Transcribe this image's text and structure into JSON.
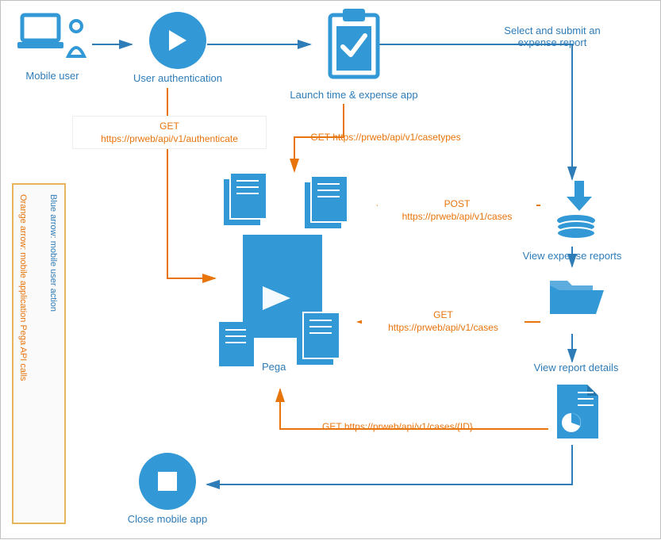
{
  "nodes": {
    "mobile_user": "Mobile user",
    "user_auth": "User authentication",
    "launch_app": "Launch time & expense app",
    "pega": "Pega",
    "close_app": "Close mobile app",
    "view_expense_reports": "View expense reports",
    "view_report_details": "View report details"
  },
  "actions": {
    "select_submit": "Select and submit an expense report"
  },
  "api": {
    "authenticate": {
      "method": "GET",
      "url": "https://prweb/api/v1/authenticate"
    },
    "casetypes": {
      "method": "GET",
      "url": "https://prweb/api/v1/casetypes"
    },
    "post_cases": {
      "method": "POST",
      "url": "https://prweb/api/v1/cases"
    },
    "get_cases": {
      "method": "GET",
      "url": "https://prweb/api/v1/cases"
    },
    "get_case_id": {
      "method": "GET",
      "url": "https://prweb/api/v1/cases/{ID}"
    }
  },
  "legend": {
    "blue": "Blue arrow: mobile user action",
    "orange": "Orange arrow: mobile application Pega API calls"
  },
  "colors": {
    "blue": "#2e7cb8",
    "icon_blue": "#3399d6",
    "orange": "#e8740c",
    "legend_border": "#e8b65a"
  }
}
